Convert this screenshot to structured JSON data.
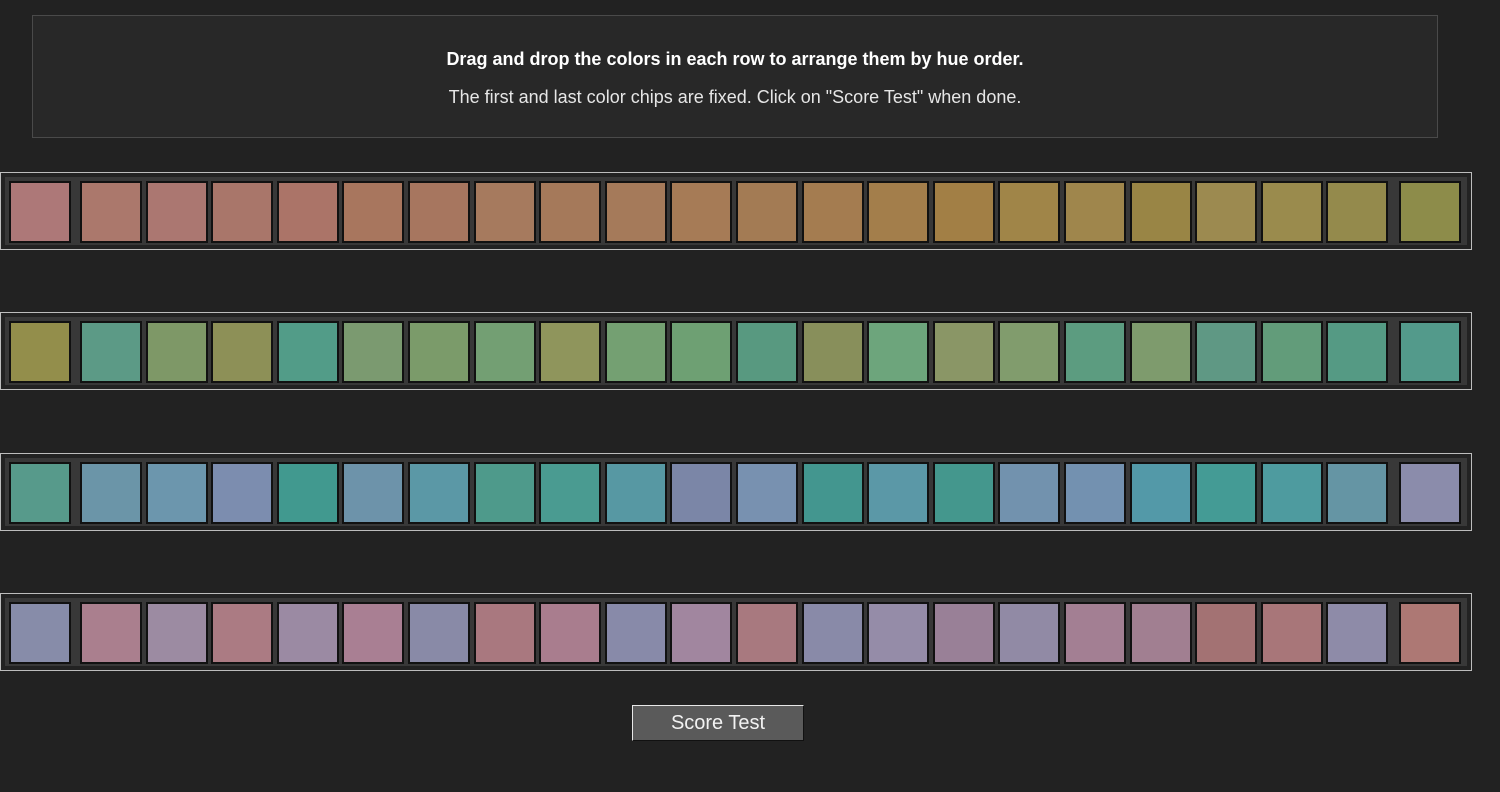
{
  "instructions": {
    "headline": "Drag and drop the colors in each row to arrange them by hue order.",
    "subline": "The first and last color chips are fixed. Click on \"Score Test\" when done."
  },
  "rows": [
    {
      "chips": [
        "#ad7878",
        "#ab786c",
        "#ab7771",
        "#a9766a",
        "#ab7468",
        "#a8765e",
        "#a7765f",
        "#a67a5e",
        "#a5795a",
        "#a57a5a",
        "#a67b56",
        "#a37b54",
        "#a47c50",
        "#a37e4b",
        "#a27f45",
        "#a08548",
        "#9f864c",
        "#998545",
        "#9c8a50",
        "#9a8b4d",
        "#948a4c",
        "#8d8c4a"
      ]
    },
    {
      "chips": [
        "#938e4b",
        "#5c9a86",
        "#7e9867",
        "#8d9057",
        "#529c88",
        "#7b9a70",
        "#7b9b6a",
        "#739f73",
        "#8f955c",
        "#74a072",
        "#6ea073",
        "#589980",
        "#888f5b",
        "#6da57c",
        "#8a9666",
        "#819c6d",
        "#5c9c80",
        "#7e9b6d",
        "#5f9884",
        "#629c7a",
        "#559a84",
        "#539a8b"
      ]
    },
    {
      "chips": [
        "#579a8b",
        "#6b95a8",
        "#6c96ad",
        "#7c8daf",
        "#41998f",
        "#6d93aa",
        "#5b98a6",
        "#4e9a8b",
        "#4a9b91",
        "#5798a3",
        "#7b86a7",
        "#7891b0",
        "#43968f",
        "#5b98a7",
        "#44978d",
        "#7292ae",
        "#7391b0",
        "#5399a8",
        "#449b95",
        "#4e9b9f",
        "#6595a4",
        "#8b8cab"
      ]
    },
    {
      "chips": [
        "#878ca9",
        "#aa7f8e",
        "#9c8ba2",
        "#ab7b83",
        "#9b8aa3",
        "#a97f93",
        "#898aa7",
        "#a9787f",
        "#a97d8e",
        "#888aa9",
        "#a1869f",
        "#a8797f",
        "#898aa8",
        "#958ca8",
        "#998097",
        "#918aa5",
        "#a37f93",
        "#a17f91",
        "#a37273",
        "#a87679",
        "#8e8ba8",
        "#ad7874"
      ]
    }
  ],
  "score_button": {
    "label": "Score Test"
  }
}
